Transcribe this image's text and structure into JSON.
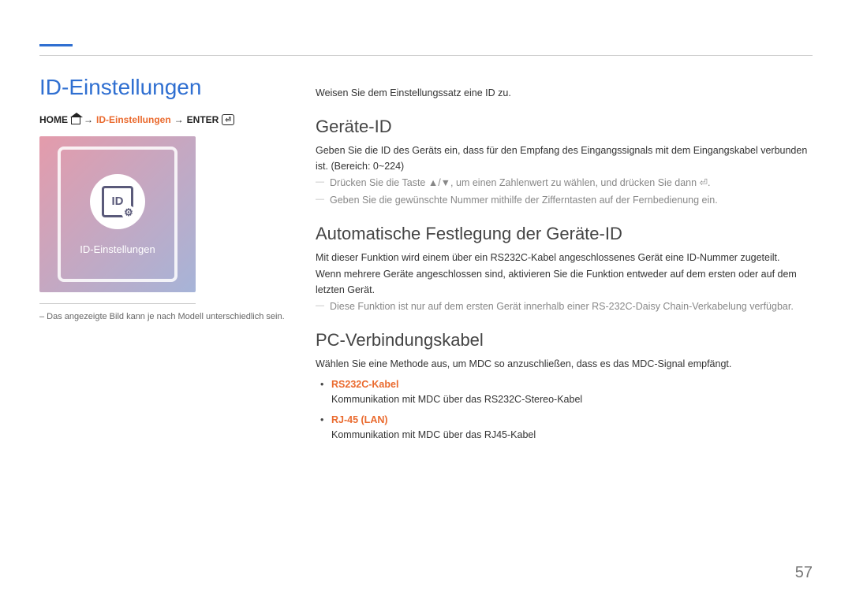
{
  "page_title": "ID-Einstellungen",
  "breadcrumb": {
    "home": "HOME",
    "arrow": "→",
    "current": "ID-Einstellungen",
    "enter": "ENTER"
  },
  "thumbnail": {
    "badge_text": "ID",
    "label": "ID-Einstellungen"
  },
  "image_note": "– Das angezeigte Bild kann je nach Modell unterschiedlich sein.",
  "intro": "Weisen Sie dem Einstellungssatz eine ID zu.",
  "sections": {
    "device_id": {
      "heading": "Geräte-ID",
      "p1": "Geben Sie die ID des Geräts ein, dass für den Empfang des Eingangssignals mit dem Eingangskabel verbunden ist. (Bereich: 0~224)",
      "note1": "Drücken Sie die Taste ▲/▼, um einen Zahlenwert zu wählen, und drücken Sie dann ⏎.",
      "note2": "Geben Sie die gewünschte Nummer mithilfe der Zifferntasten auf der Fernbedienung ein."
    },
    "auto_id": {
      "heading": "Automatische Festlegung der Geräte-ID",
      "p1": "Mit dieser Funktion wird einem über ein RS232C-Kabel angeschlossenes Gerät eine ID-Nummer zugeteilt.",
      "p2": "Wenn mehrere Geräte angeschlossen sind, aktivieren Sie die Funktion entweder auf dem ersten oder auf dem letzten Gerät.",
      "note1": "Diese Funktion ist nur auf dem ersten Gerät innerhalb einer RS-232C-Daisy Chain-Verkabelung verfügbar."
    },
    "pc_cable": {
      "heading": "PC-Verbindungskabel",
      "p1": "Wählen Sie eine Methode aus, um MDC so anzuschließen, dass es das MDC-Signal empfängt.",
      "options": [
        {
          "title": "RS232C-Kabel",
          "desc": "Kommunikation mit MDC über das RS232C-Stereo-Kabel"
        },
        {
          "title": "RJ-45 (LAN)",
          "desc": "Kommunikation mit MDC über das RJ45-Kabel"
        }
      ]
    }
  },
  "page_number": "57"
}
